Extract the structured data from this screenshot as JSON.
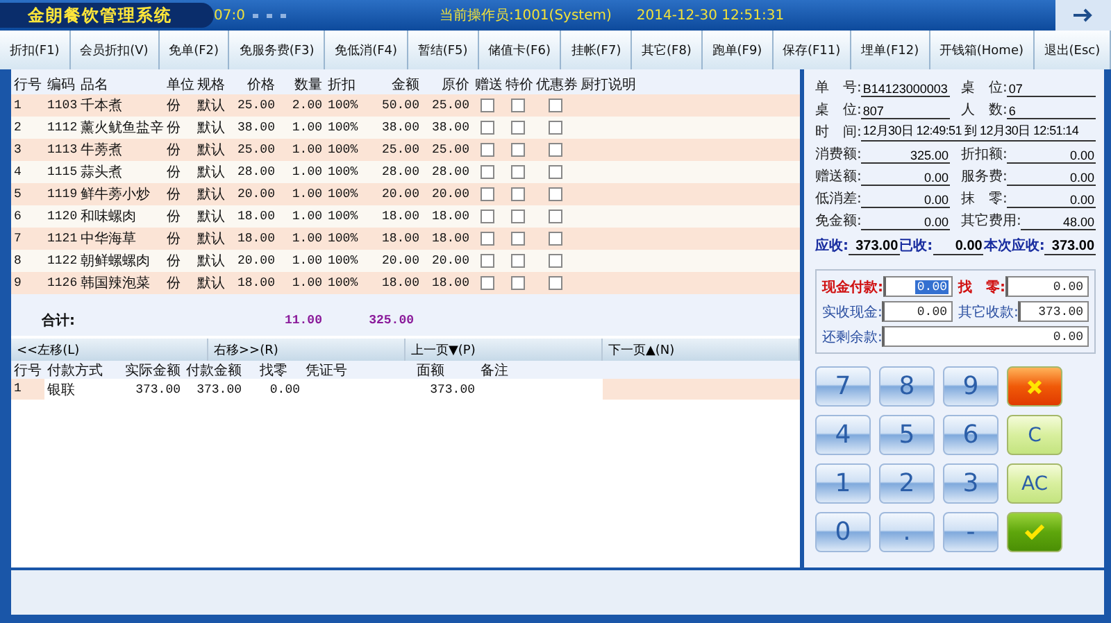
{
  "window": {
    "title": "金朗餐饮管理系统",
    "ticker": "07:0",
    "operator": "当前操作员:1001(System)",
    "datetime": "2014-12-30 12:51:31"
  },
  "toolbar": [
    "折扣(F1)",
    "会员折扣(V)",
    "免单(F2)",
    "免服务费(F3)",
    "免低消(F4)",
    "暂结(F5)",
    "储值卡(F6)",
    "挂帐(F7)",
    "其它(F8)",
    "跑单(F9)",
    "保存(F11)",
    "埋单(F12)",
    "开钱箱(Home)",
    "退出(Esc)"
  ],
  "items": {
    "columns": [
      "行号",
      "编码",
      "品名",
      "单位",
      "规格",
      "价格",
      "数量",
      "折扣",
      "金额",
      "原价",
      "赠送",
      "特价",
      "优惠券",
      "厨打说明"
    ],
    "rows": [
      {
        "no": "1",
        "code": "1103",
        "name": "千本煮",
        "unit": "份",
        "spec": "默认",
        "price": "25.00",
        "qty": "2.00",
        "discount": "100%",
        "amount": "50.00",
        "orig": "25.00",
        "gift": false,
        "special": false,
        "coupon": false
      },
      {
        "no": "2",
        "code": "1112",
        "name": "薰火鱿鱼盐辛",
        "unit": "份",
        "spec": "默认",
        "price": "38.00",
        "qty": "1.00",
        "discount": "100%",
        "amount": "38.00",
        "orig": "38.00",
        "gift": false,
        "special": false,
        "coupon": false
      },
      {
        "no": "3",
        "code": "1113",
        "name": "牛蒡煮",
        "unit": "份",
        "spec": "默认",
        "price": "25.00",
        "qty": "1.00",
        "discount": "100%",
        "amount": "25.00",
        "orig": "25.00",
        "gift": false,
        "special": false,
        "coupon": false
      },
      {
        "no": "4",
        "code": "1115",
        "name": "蒜头煮",
        "unit": "份",
        "spec": "默认",
        "price": "28.00",
        "qty": "1.00",
        "discount": "100%",
        "amount": "28.00",
        "orig": "28.00",
        "gift": false,
        "special": false,
        "coupon": false
      },
      {
        "no": "5",
        "code": "1119",
        "name": "鲜牛蒡小炒",
        "unit": "份",
        "spec": "默认",
        "price": "20.00",
        "qty": "1.00",
        "discount": "100%",
        "amount": "20.00",
        "orig": "20.00",
        "gift": false,
        "special": false,
        "coupon": false
      },
      {
        "no": "6",
        "code": "1120",
        "name": "和味螺肉",
        "unit": "份",
        "spec": "默认",
        "price": "18.00",
        "qty": "1.00",
        "discount": "100%",
        "amount": "18.00",
        "orig": "18.00",
        "gift": false,
        "special": false,
        "coupon": false
      },
      {
        "no": "7",
        "code": "1121",
        "name": "中华海草",
        "unit": "份",
        "spec": "默认",
        "price": "18.00",
        "qty": "1.00",
        "discount": "100%",
        "amount": "18.00",
        "orig": "18.00",
        "gift": false,
        "special": false,
        "coupon": false
      },
      {
        "no": "8",
        "code": "1122",
        "name": "朝鲜螺螺肉",
        "unit": "份",
        "spec": "默认",
        "price": "20.00",
        "qty": "1.00",
        "discount": "100%",
        "amount": "20.00",
        "orig": "20.00",
        "gift": false,
        "special": false,
        "coupon": false
      },
      {
        "no": "9",
        "code": "1126",
        "name": "韩国辣泡菜",
        "unit": "份",
        "spec": "默认",
        "price": "18.00",
        "qty": "1.00",
        "discount": "100%",
        "amount": "18.00",
        "orig": "18.00",
        "gift": false,
        "special": false,
        "coupon": false
      }
    ],
    "total": {
      "label": "合计:",
      "qty": "11.00",
      "amount": "325.00"
    }
  },
  "pager": [
    "<<左移(L)",
    "右移>>(R)",
    "上一页▼(P)",
    "下一页▲(N)"
  ],
  "payments": {
    "columns": [
      "行号",
      "付款方式",
      "实际金额",
      "付款金额",
      "找零",
      "凭证号",
      "面额",
      "备注"
    ],
    "rows": [
      {
        "no": "1",
        "method": "银联",
        "actual": "373.00",
        "paid": "373.00",
        "change": "0.00",
        "amount": "373.00"
      }
    ]
  },
  "bill": {
    "fields": [
      {
        "label": "单　号:",
        "value": "B14123000003"
      },
      {
        "label": "桌　位:",
        "value": "07"
      },
      {
        "label": "桌　位:",
        "value": "807"
      },
      {
        "label": "人　数:",
        "value": "6"
      }
    ],
    "time": {
      "label": "时　间:",
      "value": "12月30日 12:49:51 到 12月30日 12:51:14"
    },
    "amounts": [
      {
        "label": "消费额:",
        "value": "325.00"
      },
      {
        "label": "折扣额:",
        "value": "0.00"
      },
      {
        "label": "赠送额:",
        "value": "0.00"
      },
      {
        "label": "服务费:",
        "value": "0.00"
      },
      {
        "label": "低消差:",
        "value": "0.00"
      },
      {
        "label": "抹　零:",
        "value": "0.00"
      },
      {
        "label": "免金额:",
        "value": "0.00"
      },
      {
        "label": "其它费用:",
        "value": "48.00"
      }
    ],
    "receivable": [
      {
        "label": "应收:",
        "value": "373.00"
      },
      {
        "label": "已收:",
        "value": "0.00"
      },
      {
        "label": "本次应收:",
        "value": "373.00"
      }
    ]
  },
  "payment_fields": [
    {
      "label": "现金付款:",
      "value": "0.00",
      "kind": "primary",
      "selected": true
    },
    {
      "label": "找　零:",
      "value": "0.00",
      "kind": "primary",
      "selected": false
    },
    {
      "label": "实收现金:",
      "value": "0.00",
      "kind": "secondary",
      "selected": false
    },
    {
      "label": "其它收款:",
      "value": "373.00",
      "kind": "secondary",
      "selected": false
    },
    {
      "label": "还剩余款:",
      "value": "0.00",
      "kind": "balance",
      "selected": false
    }
  ],
  "keypad": [
    {
      "kind": "digit",
      "label": "7"
    },
    {
      "kind": "digit",
      "label": "8"
    },
    {
      "kind": "digit",
      "label": "9"
    },
    {
      "kind": "cancel"
    },
    {
      "kind": "digit",
      "label": "4"
    },
    {
      "kind": "digit",
      "label": "5"
    },
    {
      "kind": "digit",
      "label": "6"
    },
    {
      "kind": "clear",
      "label": "C"
    },
    {
      "kind": "digit",
      "label": "1"
    },
    {
      "kind": "digit",
      "label": "2"
    },
    {
      "kind": "digit",
      "label": "3"
    },
    {
      "kind": "clear",
      "label": "AC"
    },
    {
      "kind": "digit",
      "label": "0"
    },
    {
      "kind": "digit",
      "label": "."
    },
    {
      "kind": "digit",
      "label": "-"
    },
    {
      "kind": "confirm"
    }
  ]
}
